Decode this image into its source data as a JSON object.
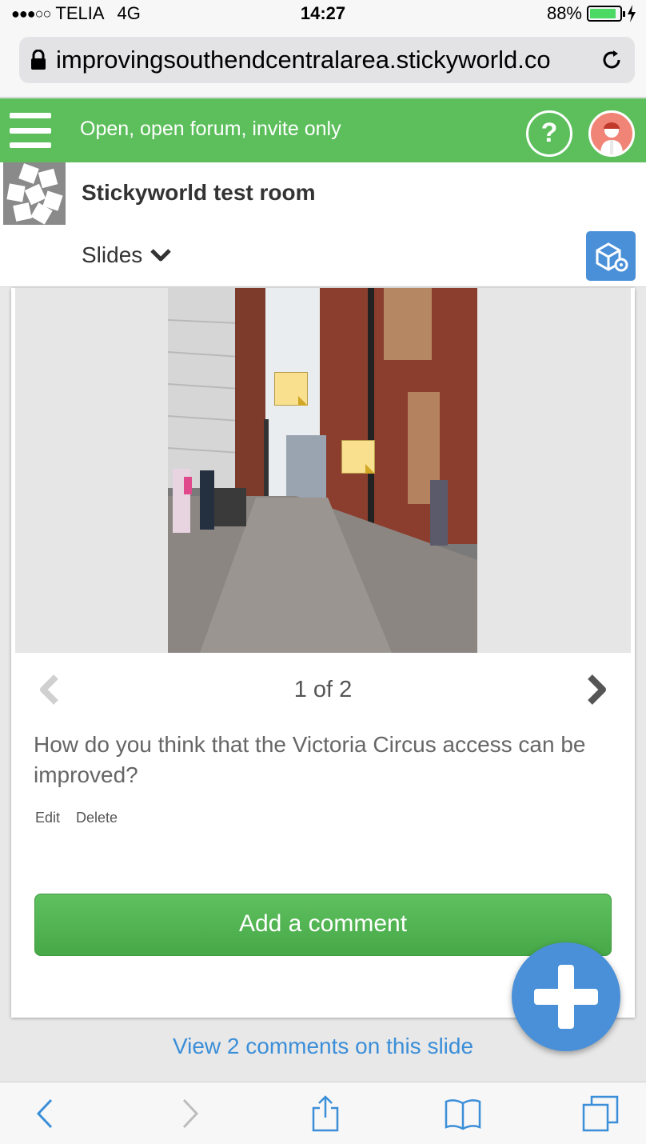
{
  "status_bar": {
    "signal": "●●●○○",
    "carrier": "TELIA",
    "network": "4G",
    "time": "14:27",
    "battery_percent": "88%",
    "battery_level": 0.88
  },
  "browser": {
    "url": "improvingsouthendcentralarea.stickyworld.co"
  },
  "header": {
    "room_access": "Open, open forum, invite only",
    "help_label": "?"
  },
  "room": {
    "title": "Stickyworld test room",
    "slides_dropdown_label": "Slides"
  },
  "slide": {
    "pager_text": "1 of 2",
    "question": "How do you think that the Victoria Circus access can be improved?",
    "edit_label": "Edit",
    "delete_label": "Delete"
  },
  "comments": {
    "add_button_label": "Add a comment",
    "view_link_label": "View 2 comments on this slide"
  },
  "colors": {
    "header_green": "#5cbf5c",
    "accent_blue": "#4a90d9",
    "link_blue": "#3b8ed8",
    "sticky_note_yellow": "#f8e08e"
  },
  "icons": {
    "menu": "hamburger-icon",
    "help": "question-icon",
    "user": "avatar-icon",
    "settings": "cube-gear-icon",
    "fab": "plus-icon",
    "toolbar": [
      "back-icon",
      "forward-icon",
      "share-icon",
      "bookmarks-icon",
      "tabs-icon"
    ]
  }
}
